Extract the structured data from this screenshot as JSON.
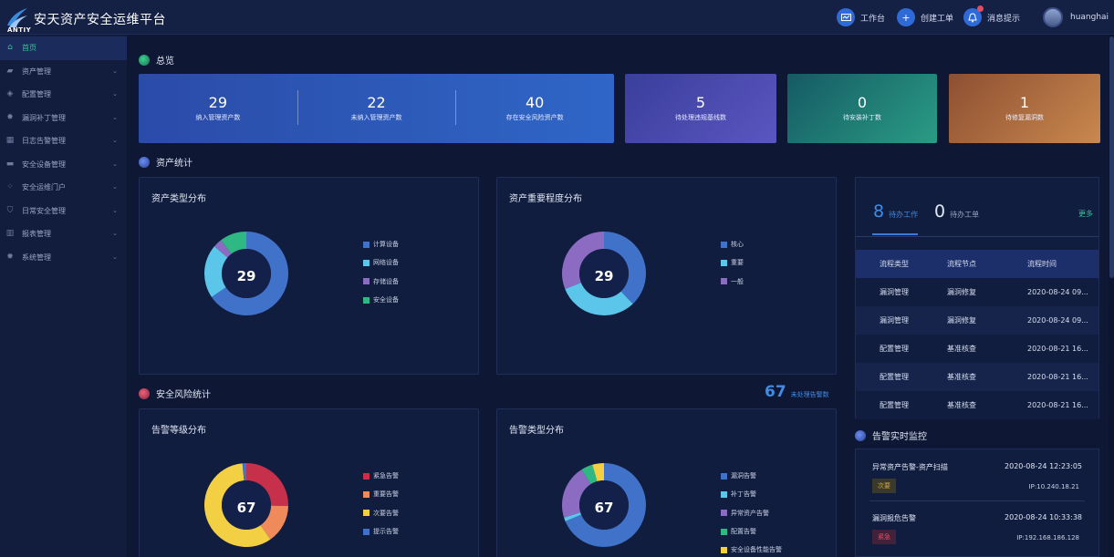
{
  "app": {
    "title": "安天资产安全运维平台",
    "logo_text": "ANTIY"
  },
  "topbar": {
    "workbench": "工作台",
    "create_order": "创建工单",
    "messages": "消息提示",
    "username": "huanghai"
  },
  "sidebar": {
    "items": [
      {
        "label": "首页",
        "icon": "home-icon",
        "active": true,
        "chevron": false
      },
      {
        "label": "资产管理",
        "icon": "folder-icon",
        "chevron": true
      },
      {
        "label": "配置管理",
        "icon": "cube-icon",
        "chevron": true
      },
      {
        "label": "漏洞补丁管理",
        "icon": "bug-icon",
        "chevron": true
      },
      {
        "label": "日志告警管理",
        "icon": "calendar-icon",
        "chevron": true
      },
      {
        "label": "安全设备管理",
        "icon": "monitor-icon",
        "chevron": true
      },
      {
        "label": "安全运维门户",
        "icon": "grid-icon",
        "chevron": true
      },
      {
        "label": "日常安全管理",
        "icon": "shield-icon",
        "chevron": true
      },
      {
        "label": "报表管理",
        "icon": "bar-chart-icon",
        "chevron": true
      },
      {
        "label": "系统管理",
        "icon": "gear-icon",
        "chevron": true
      }
    ]
  },
  "overview": {
    "title": "总览",
    "summary": [
      {
        "value": "29",
        "label": "纳入管理资产数"
      },
      {
        "value": "22",
        "label": "未纳入管理资产数"
      },
      {
        "value": "40",
        "label": "存在安全风险资产数"
      }
    ],
    "cards": [
      {
        "value": "5",
        "label": "待处理违规基线数",
        "color": "#3a49a8"
      },
      {
        "value": "0",
        "label": "待安装补丁数",
        "color": "#1e7c7a"
      },
      {
        "value": "1",
        "label": "待修复漏洞数",
        "color": "#b06a3c"
      }
    ]
  },
  "asset_stats": {
    "title": "资产统计"
  },
  "asset_type": {
    "title": "资产类型分布",
    "total": "29",
    "legend": [
      "计算设备",
      "网络设备",
      "存储设备",
      "安全设备"
    ]
  },
  "asset_importance": {
    "title": "资产重要程度分布",
    "total": "29",
    "legend": [
      "核心",
      "重要",
      "一般"
    ]
  },
  "risk_stats": {
    "title": "安全风险统计",
    "alarm_count": "67",
    "alarm_label": "未处理告警数"
  },
  "alarm_level": {
    "title": "告警等级分布",
    "total": "67",
    "legend": [
      "紧急告警",
      "重要告警",
      "次要告警",
      "提示告警"
    ]
  },
  "alarm_type": {
    "title": "告警类型分布",
    "total": "67",
    "legend": [
      "漏洞告警",
      "补丁告警",
      "异常资产告警",
      "配置告警",
      "安全设备性能告警"
    ]
  },
  "tasks": {
    "pending_count": "8",
    "pending_label": "待办工作",
    "order_count": "0",
    "order_label": "待办工单",
    "more": "更多",
    "headers": [
      "流程类型",
      "流程节点",
      "流程时间"
    ],
    "rows": [
      [
        "漏洞管理",
        "漏洞修复",
        "2020-08-24 09..."
      ],
      [
        "漏洞管理",
        "漏洞修复",
        "2020-08-24 09..."
      ],
      [
        "配置管理",
        "基准核查",
        "2020-08-21 16..."
      ],
      [
        "配置管理",
        "基准核查",
        "2020-08-21 16..."
      ],
      [
        "配置管理",
        "基准核查",
        "2020-08-21 16..."
      ]
    ]
  },
  "monitor": {
    "title": "告警实时监控",
    "items": [
      {
        "title": "异常资产告警-资产扫描",
        "time": "2020-08-24 12:23:05",
        "badge": "次要",
        "ip": "IP:10.240.18.21",
        "badge_color": "#d9a53a"
      },
      {
        "title": "漏洞报危告警",
        "time": "2020-08-24 10:33:38",
        "badge": "紧急",
        "ip": "IP:192.168.186.128",
        "badge_color": "#e0506a"
      }
    ]
  },
  "chart_data": [
    {
      "type": "pie",
      "title": "资产类型分布",
      "categories": [
        "计算设备",
        "网络设备",
        "存储设备",
        "安全设备"
      ],
      "values": [
        19,
        6,
        1,
        3
      ],
      "colors": [
        "#3f72c8",
        "#5bc6ea",
        "#8b6cc2",
        "#2fb884"
      ]
    },
    {
      "type": "pie",
      "title": "资产重要程度分布",
      "categories": [
        "核心",
        "重要",
        "一般"
      ],
      "values": [
        11,
        9,
        9
      ],
      "colors": [
        "#3f72c8",
        "#5bc6ea",
        "#8b6cc2"
      ]
    },
    {
      "type": "pie",
      "title": "告警等级分布",
      "categories": [
        "紧急告警",
        "重要告警",
        "次要告警",
        "提示告警"
      ],
      "values": [
        17,
        10,
        39,
        1
      ],
      "colors": [
        "#c7304a",
        "#ef8a5b",
        "#f3cf43",
        "#3f72c8"
      ]
    },
    {
      "type": "pie",
      "title": "告警类型分布",
      "categories": [
        "漏洞告警",
        "补丁告警",
        "异常资产告警",
        "配置告警",
        "安全设备性能告警"
      ],
      "values": [
        46,
        1,
        14,
        3,
        3
      ],
      "colors": [
        "#3f72c8",
        "#5bc6ea",
        "#8b6cc2",
        "#2fb884",
        "#f3cf43"
      ]
    }
  ]
}
